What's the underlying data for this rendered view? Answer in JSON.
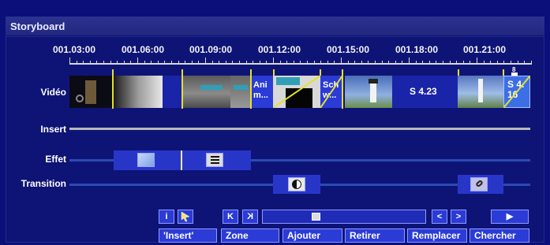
{
  "window": {
    "title": "Storyboard"
  },
  "timeline": {
    "timecodes": [
      "001.03:00",
      "001.06:00",
      "001.09:00",
      "001.12:00",
      "001.15:00",
      "001.18:00",
      "001.21:00"
    ],
    "end_marker": "8"
  },
  "tracks": {
    "video": "Vidéo",
    "insert": "Insert",
    "effect": "Effet",
    "transition": "Transition"
  },
  "clips": {
    "anim_label": "Ani m...",
    "schw_label": "Sch w...",
    "s423_label": "S 4.23",
    "s416_label": "S 4. 16"
  },
  "toolbar": {
    "info": "i",
    "cursor_icon": "cursor-arrow-icon",
    "first": "K",
    "last": "K",
    "prev": "<",
    "next": ">",
    "play": "▶"
  },
  "buttons": {
    "insert": "'Insert'",
    "zone": "Zone",
    "ajouter": "Ajouter",
    "retirer": "Retirer",
    "remplacer": "Remplacer",
    "chercher": "Chercher"
  },
  "colors": {
    "background": "#0b0f7a",
    "accent": "#2b3bd6",
    "marker": "#e6e02a"
  }
}
